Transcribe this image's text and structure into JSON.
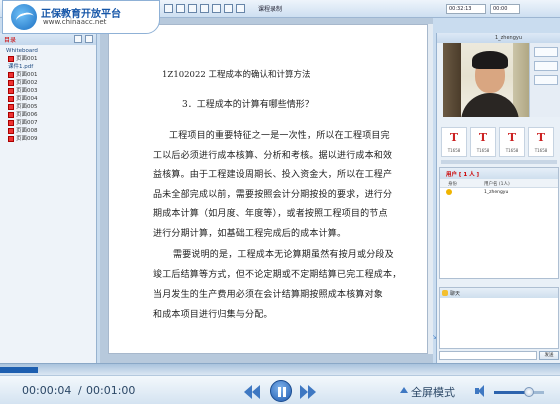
{
  "brand": {
    "name": "正保教育开放平台",
    "url": "www.chinaacc.net"
  },
  "toolbar": {
    "title": "课程录制",
    "time1": "00:32:13",
    "time2": "00:00"
  },
  "left_panel": {
    "header": "目录",
    "root": "Whiteboard",
    "pages_root": [
      {
        "label": "页面001"
      }
    ],
    "doc_name": "课件1.pdf",
    "pages": [
      {
        "label": "页面001"
      },
      {
        "label": "页面002"
      },
      {
        "label": "页面003"
      },
      {
        "label": "页面004"
      },
      {
        "label": "页面005"
      },
      {
        "label": "页面006"
      },
      {
        "label": "页面007"
      },
      {
        "label": "页面008"
      },
      {
        "label": "页面009"
      }
    ]
  },
  "document": {
    "title": "1Z102022  工程成本的确认和计算方法",
    "question": "3．工程成本的计算有哪些情形？",
    "para1": [
      "工程项目的重要特征之一是一次性，所以在工程项目完",
      "工以后必须进行成本核算、分析和考核。据以进行成本和效",
      "益核算。由于工程建设周期长、投入资金大，所以在工程产",
      "品未全部完成以前，需要按照会计分期按投的要求，进行分",
      "期成本计算（如月度、年度等），或者按照工程项目的节点",
      "进行分期计算，如基础工程完成后的成本计算。"
    ],
    "para2": [
      "需要说明的是，工程成本无论算期虽然有按月或分段及",
      "竣工后结算等方式，但不论定期或不定期结算已完工程成本，",
      "当月发生的生产费用必须在会计结算期按照成本核算对象",
      "和成本项目进行归集与分配。"
    ]
  },
  "right_panel": {
    "user_label": "1_zhengyu",
    "thumbs": [
      {
        "label": "T1658"
      },
      {
        "label": "T1658"
      },
      {
        "label": "T1658"
      },
      {
        "label": "T1658"
      }
    ],
    "users_title": "用户 [ 1 人 ]",
    "users_cols": {
      "role": "身份",
      "name": "用户名 (1人)"
    },
    "user": {
      "name": "1_zhengyu"
    },
    "chat_title": "聊天",
    "send_label": "发送"
  },
  "player": {
    "current_time": "00:00:04",
    "separator": "/",
    "total_time": "00:01:00",
    "progress": 0.067,
    "fullscreen_label": "全屏模式",
    "volume": 0.7
  },
  "colors": {
    "accent": "#1e5fb0",
    "panel": "#c9dcef"
  }
}
